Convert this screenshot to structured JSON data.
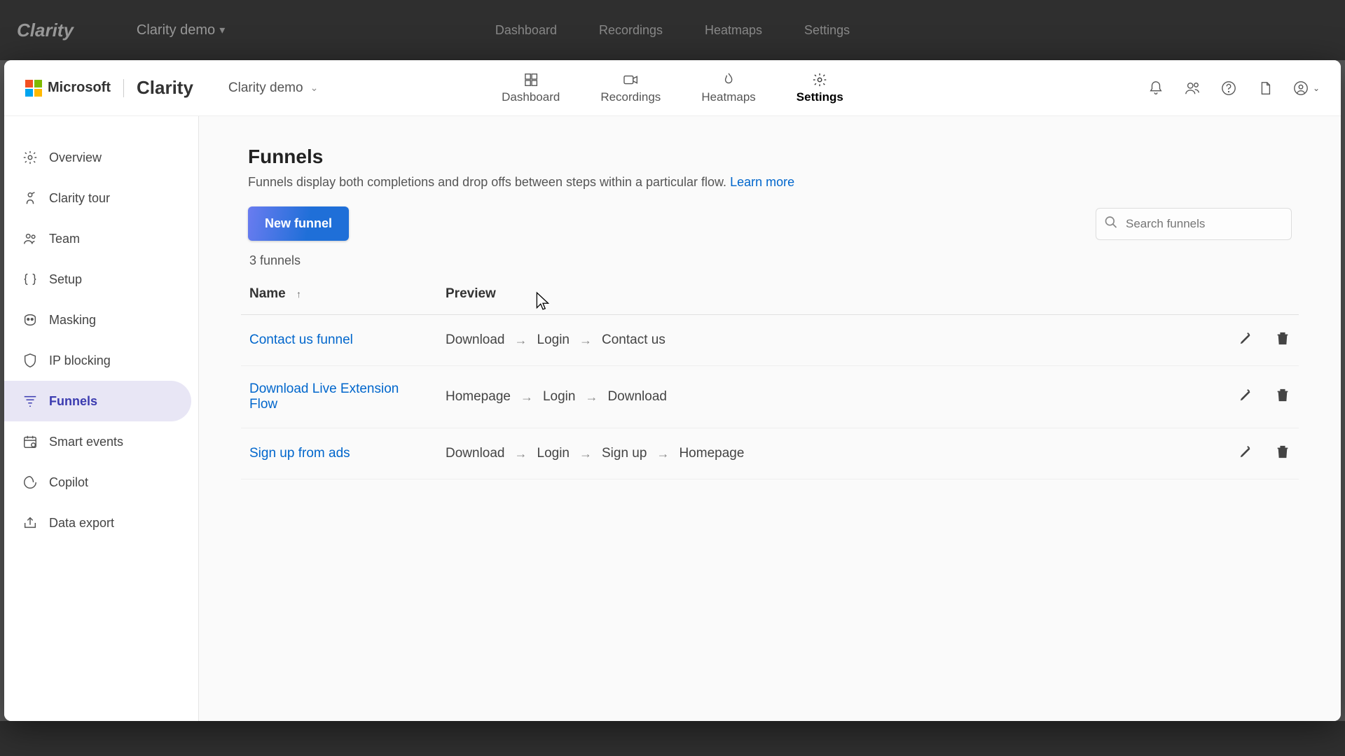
{
  "background": {
    "app_name": "Clarity",
    "project": "Clarity demo",
    "tabs": [
      "Dashboard",
      "Recordings",
      "Heatmaps",
      "Settings"
    ]
  },
  "header": {
    "company": "Microsoft",
    "product": "Clarity",
    "project": "Clarity demo",
    "tabs": [
      {
        "id": "dashboard",
        "label": "Dashboard",
        "active": false
      },
      {
        "id": "recordings",
        "label": "Recordings",
        "active": false
      },
      {
        "id": "heatmaps",
        "label": "Heatmaps",
        "active": false
      },
      {
        "id": "settings",
        "label": "Settings",
        "active": true
      }
    ]
  },
  "sidebar": {
    "items": [
      {
        "id": "overview",
        "label": "Overview",
        "active": false,
        "icon": "gear"
      },
      {
        "id": "tour",
        "label": "Clarity tour",
        "active": false,
        "icon": "tour"
      },
      {
        "id": "team",
        "label": "Team",
        "active": false,
        "icon": "team"
      },
      {
        "id": "setup",
        "label": "Setup",
        "active": false,
        "icon": "braces"
      },
      {
        "id": "masking",
        "label": "Masking",
        "active": false,
        "icon": "mask"
      },
      {
        "id": "ipblock",
        "label": "IP blocking",
        "active": false,
        "icon": "shield"
      },
      {
        "id": "funnels",
        "label": "Funnels",
        "active": true,
        "icon": "funnel"
      },
      {
        "id": "smartevents",
        "label": "Smart events",
        "active": false,
        "icon": "events"
      },
      {
        "id": "copilot",
        "label": "Copilot",
        "active": false,
        "icon": "copilot"
      },
      {
        "id": "dataexport",
        "label": "Data export",
        "active": false,
        "icon": "export"
      }
    ]
  },
  "page": {
    "title": "Funnels",
    "description": "Funnels display both completions and drop offs between steps within a particular flow. ",
    "learn_more": "Learn more",
    "new_button": "New funnel",
    "search_placeholder": "Search funnels",
    "count_text": "3 funnels",
    "columns": {
      "name": "Name",
      "preview": "Preview"
    },
    "rows": [
      {
        "name": "Contact us funnel",
        "steps": [
          "Download",
          "Login",
          "Contact us"
        ]
      },
      {
        "name": "Download Live Extension Flow",
        "steps": [
          "Homepage",
          "Login",
          "Download"
        ]
      },
      {
        "name": "Sign up from ads",
        "steps": [
          "Download",
          "Login",
          "Sign up",
          "Homepage"
        ]
      }
    ]
  }
}
